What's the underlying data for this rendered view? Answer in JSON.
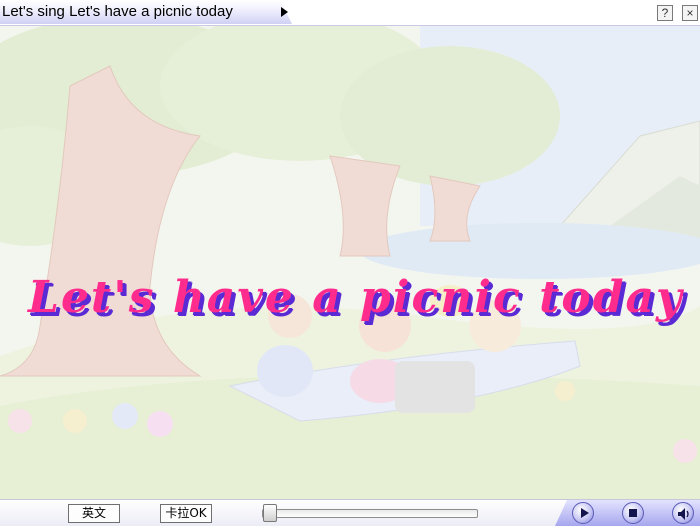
{
  "window": {
    "title": "Let's sing Let's have a picnic today",
    "help_label": "?",
    "close_label": "×"
  },
  "scene": {
    "headline": "Let's have a picnic today"
  },
  "controls": {
    "english_label": "英文",
    "karaoke_label": "卡拉OK",
    "progress": 0
  },
  "icons": {
    "title_arrow": "play-arrow-icon",
    "play": "play-icon",
    "stop": "stop-icon",
    "sound": "speaker-icon"
  },
  "colors": {
    "headline": "#ff2c8e",
    "headline_shadow": "#5a2ad4",
    "media_panel": "#a6a6ee"
  }
}
